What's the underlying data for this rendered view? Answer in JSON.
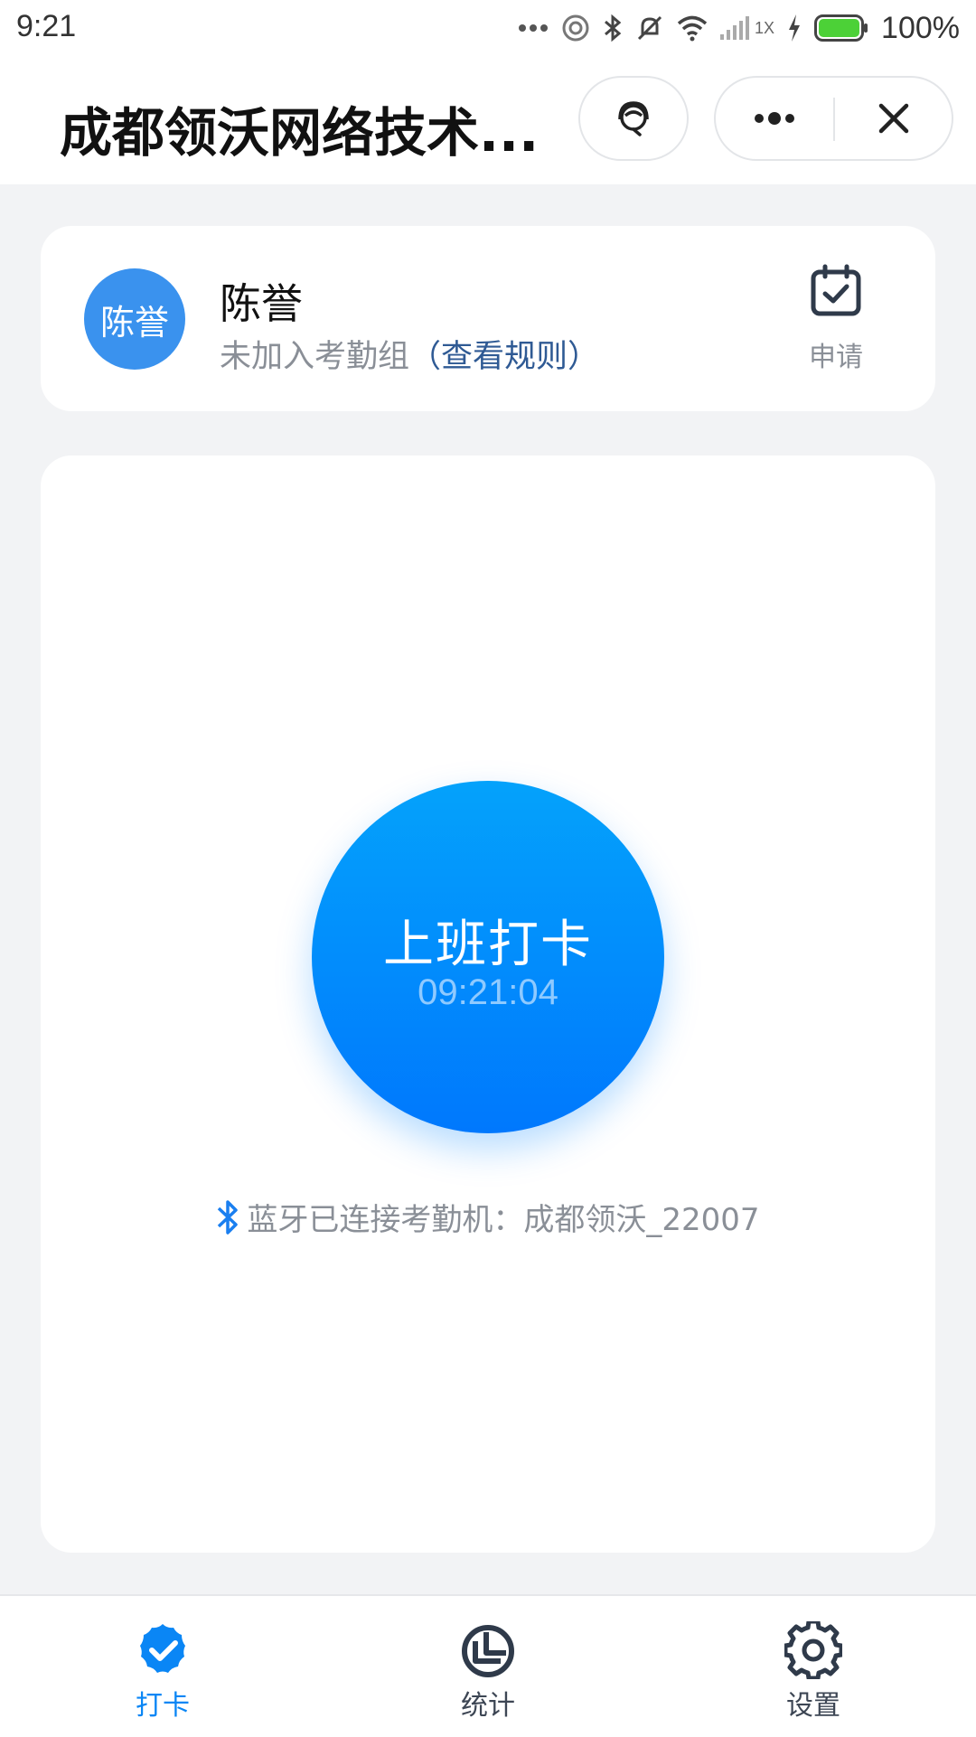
{
  "status_bar": {
    "time": "9:21",
    "network_label": "1X",
    "battery": "100%"
  },
  "title_bar": {
    "title": "成都领沃网络技术...",
    "icons": [
      "customer-service-icon",
      "more-icon",
      "close-icon"
    ]
  },
  "profile": {
    "avatar_text": "陈誉",
    "name": "陈誉",
    "group_status": "未加入考勤组",
    "rule_link": "（查看规则）",
    "apply_label": "申请"
  },
  "punch": {
    "label": "上班打卡",
    "time": "09:21:04"
  },
  "bluetooth": {
    "text": "蓝牙已连接考勤机：成都领沃_22007"
  },
  "tabs": [
    {
      "label": "打卡",
      "icon": "check-badge-icon",
      "active": true
    },
    {
      "label": "统计",
      "icon": "pie-chart-icon",
      "active": false
    },
    {
      "label": "设置",
      "icon": "gear-icon",
      "active": false
    }
  ],
  "colors": {
    "accent": "#0a86f5",
    "punch_gradient_top": "#04a2fb",
    "punch_gradient_bottom": "#0078fd",
    "avatar": "#3a92ee",
    "battery": "#4cd137"
  }
}
